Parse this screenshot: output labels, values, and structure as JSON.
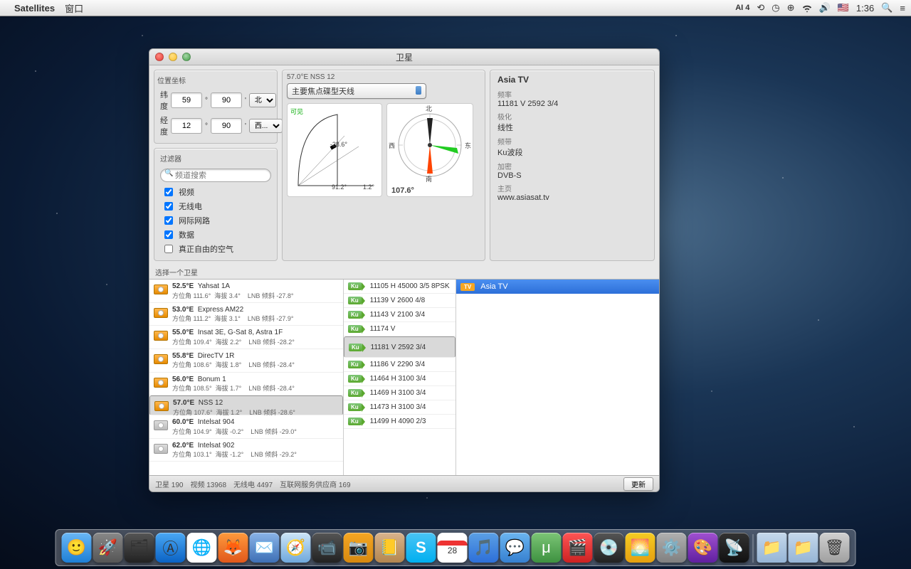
{
  "menubar": {
    "app": "Satellites",
    "menu1": "窗口",
    "clock": "1:36"
  },
  "window": {
    "title": "卫星"
  },
  "coords": {
    "section": "位置坐标",
    "lat_label": "纬度",
    "lat_val": "59",
    "lat_max": "90",
    "lat_dir": "北",
    "lon_label": "经度",
    "lon_val": "12",
    "lon_max": "90",
    "lon_dir": "西..."
  },
  "filter": {
    "section": "过滤器",
    "placeholder": "频道搜索",
    "opt1": "视频",
    "opt2": "无线电",
    "opt3": "网际网路",
    "opt4": "数据",
    "opt5": "真正自由的空气"
  },
  "mid": {
    "header": "57.0°E NSS 12",
    "dropdown": "主要焦点碟型天线",
    "visible": "可见",
    "ang1": "-28.6°",
    "ang2": "91.2°",
    "ang3": "1.2°",
    "compass_val": "107.6°",
    "n": "北",
    "s": "南",
    "e": "东",
    "w": "西"
  },
  "info": {
    "title": "Asia TV",
    "l1": "频率",
    "v1": "11181 V 2592 3/4",
    "l2": "极化",
    "v2": "线性",
    "l3": "频带",
    "v3": "Ku波段",
    "l4": "加密",
    "v4": "DVB-S",
    "l5": "主页",
    "v5": "www.asiasat.tv"
  },
  "sel_label": "选择一个卫星",
  "sats": [
    {
      "pos": "52.5°E",
      "name": "Yahsat 1A",
      "az": "方位角  111.6°",
      "el": "海拔        3.4°",
      "lnb": "LNB 倾斜  -27.8°",
      "eye": true
    },
    {
      "pos": "53.0°E",
      "name": "Express AM22",
      "az": "方位角  111.2°",
      "el": "海拔        3.1°",
      "lnb": "LNB 倾斜  -27.9°",
      "eye": true
    },
    {
      "pos": "55.0°E",
      "name": "Insat 3E, G-Sat 8, Astra 1F",
      "az": "方位角  109.4°",
      "el": "海拔        2.2°",
      "lnb": "LNB 倾斜  -28.2°",
      "eye": true
    },
    {
      "pos": "55.8°E",
      "name": "DirecTV 1R",
      "az": "方位角  108.6°",
      "el": "海拔        1.8°",
      "lnb": "LNB 倾斜  -28.4°",
      "eye": true
    },
    {
      "pos": "56.0°E",
      "name": "Bonum 1",
      "az": "方位角  108.5°",
      "el": "海拔        1.7°",
      "lnb": "LNB 倾斜  -28.4°",
      "eye": true
    },
    {
      "pos": "57.0°E",
      "name": "NSS 12",
      "az": "方位角  107.6°",
      "el": "海拔        1.2°",
      "lnb": "LNB 倾斜  -28.6°",
      "eye": true,
      "sel": true
    },
    {
      "pos": "60.0°E",
      "name": "Intelsat 904",
      "az": "方位角  104.9°",
      "el": "海拔       -0.2°",
      "lnb": "LNB 倾斜  -29.0°",
      "eye": false
    },
    {
      "pos": "62.0°E",
      "name": "Intelsat 902",
      "az": "方位角  103.1°",
      "el": "海拔       -1.2°",
      "lnb": "LNB 倾斜  -29.2°",
      "eye": false
    }
  ],
  "tps": [
    {
      "t": "11105 H 45000 3/5 8PSK"
    },
    {
      "t": "11139 V 2600 4/8"
    },
    {
      "t": "11143 V 2100 3/4"
    },
    {
      "t": "11174 V"
    },
    {
      "t": "11181 V 2592 3/4",
      "sel": true
    },
    {
      "t": "11186 V 2290 3/4"
    },
    {
      "t": "11464 H 3100 3/4"
    },
    {
      "t": "11469 H 3100 3/4"
    },
    {
      "t": "11473 H 3100 3/4"
    },
    {
      "t": "11499 H 4090 2/3"
    }
  ],
  "channel": {
    "badge": "TV",
    "name": "Asia TV"
  },
  "status": {
    "s1": "卫星  190",
    "s2": "视频 13968",
    "s3": "无线电  4497",
    "s4": "互联网服务供应商  169",
    "btn": "更新"
  }
}
